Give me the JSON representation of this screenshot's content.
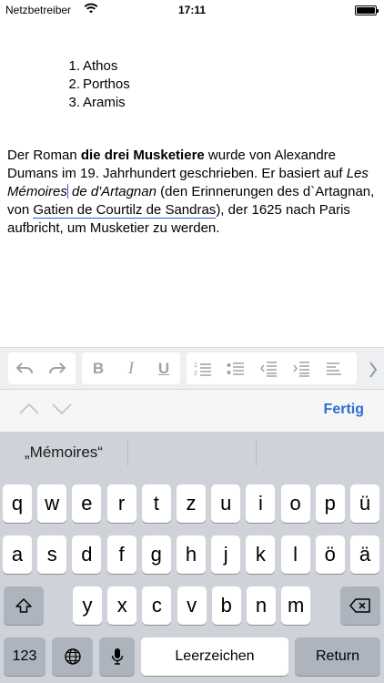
{
  "status_bar": {
    "carrier": "Netzbetreiber",
    "time": "17:11"
  },
  "document": {
    "list": [
      {
        "num": "1.",
        "text": "Athos"
      },
      {
        "num": "2.",
        "text": "Porthos"
      },
      {
        "num": "3.",
        "text": "Aramis"
      }
    ],
    "para": {
      "t1": "Der Roman ",
      "b1": "die drei Musketiere",
      "t2": " wurde von Alexandre Dumans im 19. Jahrhundert geschrieben. Er basiert auf ",
      "i1": "Les Mémoires",
      "i2": " de d'Artagnan",
      "t3": " (den Erinnerungen des d`Artagnan, von ",
      "link": "Gatien de Courtilz de Sandras",
      "t4": "), der 1625 nach Paris aufbricht, um Musketier zu werden."
    }
  },
  "toolbar": {
    "bold": "B",
    "italic": "I",
    "underline": "U"
  },
  "accessory": {
    "done": "Fertig"
  },
  "keyboard": {
    "suggestion": "„Mémoires“",
    "row1": [
      "q",
      "w",
      "e",
      "r",
      "t",
      "z",
      "u",
      "i",
      "o",
      "p",
      "ü"
    ],
    "row2": [
      "a",
      "s",
      "d",
      "f",
      "g",
      "h",
      "j",
      "k",
      "l",
      "ö",
      "ä"
    ],
    "row3": [
      "y",
      "x",
      "c",
      "v",
      "b",
      "n",
      "m"
    ],
    "numbers": "123",
    "space": "Leerzeichen",
    "return": "Return"
  }
}
